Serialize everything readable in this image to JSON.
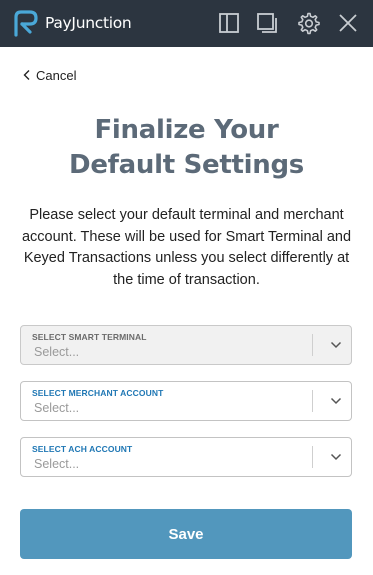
{
  "header": {
    "brand": "PayJunction",
    "brand_color": "#4aa8d8",
    "bar_color": "#2c3540",
    "icons": [
      "sidebar-panel-icon",
      "popout-window-icon",
      "settings-gear-icon",
      "close-icon"
    ]
  },
  "nav": {
    "cancel_label": "Cancel"
  },
  "main": {
    "title_line1": "Finalize Your",
    "title_line2": "Default Settings",
    "description": "Please select your default terminal and merchant account. These will be used for Smart Terminal and Keyed Transactions unless you select differently at the time of transaction."
  },
  "selects": {
    "smart_terminal": {
      "label": "SELECT SMART TERMINAL",
      "placeholder": "Select...",
      "disabled": true
    },
    "merchant_account": {
      "label": "SELECT MERCHANT ACCOUNT",
      "placeholder": "Select...",
      "disabled": false
    },
    "ach_account": {
      "label": "SELECT ACH ACCOUNT",
      "placeholder": "Select...",
      "disabled": false
    }
  },
  "actions": {
    "save_label": "Save",
    "save_color": "#5297bd"
  }
}
